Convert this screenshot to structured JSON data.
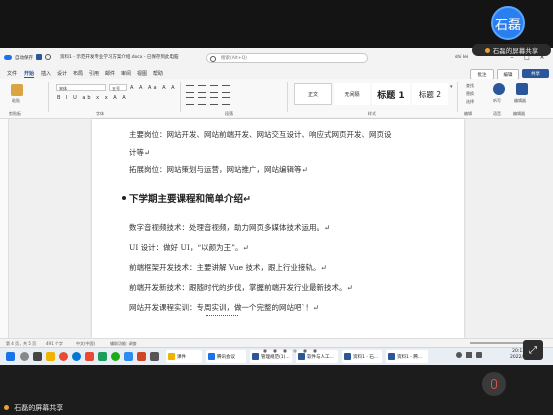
{
  "share": {
    "avatar_text": "石磊",
    "top_label": "石磊的屏幕共享",
    "bottom_label": "石磊的屏幕共享"
  },
  "word": {
    "autosave_label": "自动保存",
    "file_title": "资料1 - 示范开发专业学习方案介绍.docx - 已保存到此电脑",
    "search_placeholder": "搜索(Alt+Q)",
    "user_name": "shi lei",
    "menu": [
      "文件",
      "开始",
      "插入",
      "设计",
      "布局",
      "引用",
      "邮件",
      "审阅",
      "视图",
      "帮助"
    ],
    "active_menu": "开始",
    "right_buttons": {
      "comment": "批注",
      "edit": "编辑",
      "share": "共享"
    },
    "ribbon": {
      "paste": "粘贴",
      "clipboard": "剪贴板",
      "font_name": "宋体",
      "font_size": "五号",
      "font_group": "字体",
      "paragraph_group": "段落",
      "styles_group": "样式",
      "editing_group": "编辑",
      "voice_group": "语音",
      "editor_group": "编辑器",
      "find": "查找",
      "replace": "替换",
      "select": "选择",
      "dictate": "听写",
      "editor": "编辑器",
      "format_row1": "A A Aa A A",
      "format_row2": "B I U ab x x A A",
      "styles": [
        {
          "label": "正文",
          "size": "5px",
          "weight": "normal"
        },
        {
          "label": "无间隔",
          "size": "5px",
          "weight": "normal"
        },
        {
          "label": "标题 1",
          "size": "9px",
          "weight": "bold"
        },
        {
          "label": "标题 2",
          "size": "7.5px",
          "weight": "normal"
        }
      ]
    },
    "document": {
      "lines": [
        "主要岗位：网站开发、网站前端开发、网站交互设计、响应式网页开发、网页设",
        "计等↵",
        "拓展岗位：网站策划与运营，网站推广，网站编辑等↵"
      ],
      "heading": "下学期主要课程和简单介绍↵",
      "courses": [
        "数字音视频技术：处理音视频，助力网页多媒体技术运用。↵",
        "UI 设计：做好 UI，“以颜为王”。↵",
        "前端框架开发技术：主要讲解 Vue 技术，跟上行业接轨。↵",
        "前端开发新技术：跟随时代的步伐，掌握前端开发行业最新技术。↵",
        "网站开发课程实训：专周实训，做一个完整的网站吧`！↵"
      ]
    },
    "status": {
      "page": "第 4 页，共 5 页",
      "words": "491 个字",
      "lang": "中文(中国)",
      "accessibility": "辅助功能: 调查"
    }
  },
  "taskbar": {
    "apps": [
      {
        "label": "课件",
        "color": "#f0b400"
      },
      {
        "label": "腾讯会议",
        "color": "#1a73e8"
      },
      {
        "label": "管理规范(1)...",
        "color": "#2b579a"
      },
      {
        "label": "软件与人工...",
        "color": "#2b579a"
      },
      {
        "label": "资料1 - 石...",
        "color": "#2b579a"
      },
      {
        "label": "资料1 - 腾...",
        "color": "#2b579a"
      }
    ],
    "time": "20:13",
    "date": "2022/..."
  },
  "colors": {
    "word_blue": "#2b579a",
    "share_blue": "#2a7ff0"
  }
}
